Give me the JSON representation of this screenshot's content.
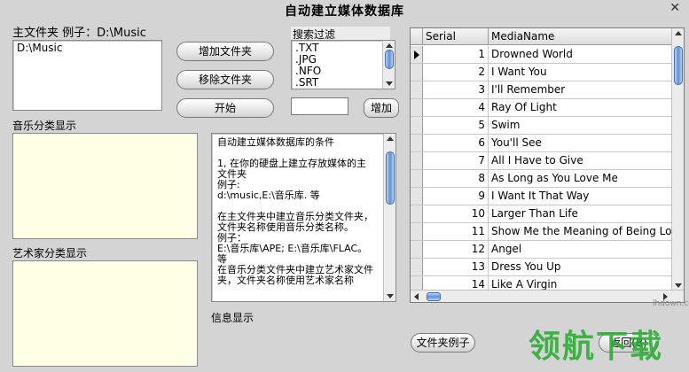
{
  "window": {
    "title": "自动建立媒体数据库",
    "close_glyph": "✕"
  },
  "main_folder": {
    "label": "主文件夹 例子：D:\\Music",
    "items": [
      "D:\\Music"
    ]
  },
  "buttons": {
    "add_folder": "增加文件夹",
    "remove_folder": "移除文件夹",
    "start": "开始",
    "add_filter": "增加",
    "folder_example": "文件夹例子",
    "back": "返回(B)"
  },
  "filter": {
    "label": "搜索过滤",
    "items": [
      ".TXT",
      ".JPG",
      ".NFO",
      ".SRT"
    ],
    "input_value": ""
  },
  "music_category": {
    "label": "音乐分类显示"
  },
  "artist_category": {
    "label": "艺术家分类显示"
  },
  "info": {
    "label": "信息显示",
    "text": "自动建立媒体数据库的条件\n\n1, 在你的硬盘上建立存放媒体的主文件夹\n例子:\nd:\\music,E:\\音乐库. 等\n\n在主文件夹中建立音乐分类文件夹，文件夹名称使用音乐分类名称。\n例子：\nE:\\音乐库\\APE; E:\\音乐库\\FLAC。等\n在音乐分类文件夹中建立艺术家文件夹，文件夹名称使用艺术家名称"
  },
  "grid": {
    "columns": [
      "Serial",
      "MediaName"
    ],
    "rows": [
      {
        "serial": "1",
        "name": "Drowned World"
      },
      {
        "serial": "2",
        "name": "I Want You"
      },
      {
        "serial": "3",
        "name": "I'll Remember"
      },
      {
        "serial": "4",
        "name": "Ray Of Light"
      },
      {
        "serial": "5",
        "name": "Swim"
      },
      {
        "serial": "6",
        "name": "You'll See"
      },
      {
        "serial": "7",
        "name": "All I Have to Give"
      },
      {
        "serial": "8",
        "name": "As Long as You Love Me"
      },
      {
        "serial": "9",
        "name": "I Want It That Way"
      },
      {
        "serial": "10",
        "name": "Larger Than Life"
      },
      {
        "serial": "11",
        "name": "Show Me the Meaning of Being Lonely"
      },
      {
        "serial": "12",
        "name": "Angel"
      },
      {
        "serial": "13",
        "name": "Dress You Up"
      },
      {
        "serial": "14",
        "name": "Like A Virgin"
      }
    ]
  },
  "watermark": {
    "text": "领航下载",
    "url": "lhdown.com",
    "color": "#2eae36"
  },
  "colors": {
    "panel_yellow": "#ffffe6",
    "background": "#d4d4d4",
    "scroll_thumb": "#5f8fd4"
  }
}
